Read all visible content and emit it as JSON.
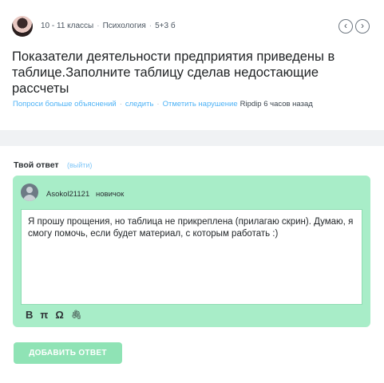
{
  "question": {
    "grade": "10 - 11 классы",
    "subject": "Психология",
    "points": "5+3 б",
    "title": "Показатели деятельности предприятия приведены в таблице.Заполните таблицу сделав недостающие рассчеты",
    "actions": {
      "ask_more": "Попроси больше объяснений",
      "follow": "следить",
      "report": "Отметить нарушение",
      "author": "Ripdip",
      "time": "6 часов назад"
    },
    "nav": {
      "prev": "‹",
      "next": "›"
    }
  },
  "answer": {
    "heading": "Твой ответ",
    "logout": "(выйти)",
    "user": {
      "name": "Asokol21121",
      "rank": "новичок"
    },
    "text": "Я прошу прощения, но таблица не прикреплена (прилагаю скрин). Думаю, я смогу помочь, если будет материал, с которым работать :)",
    "toolbar": {
      "bold": "B",
      "pi": "π",
      "omega": "Ω",
      "attach": "🖇"
    },
    "submit": "ДОБАВИТЬ ОТВЕТ"
  },
  "colors": {
    "accent": "#a8edc8",
    "link": "#4fb3f6",
    "button": "#8fe3b5"
  }
}
